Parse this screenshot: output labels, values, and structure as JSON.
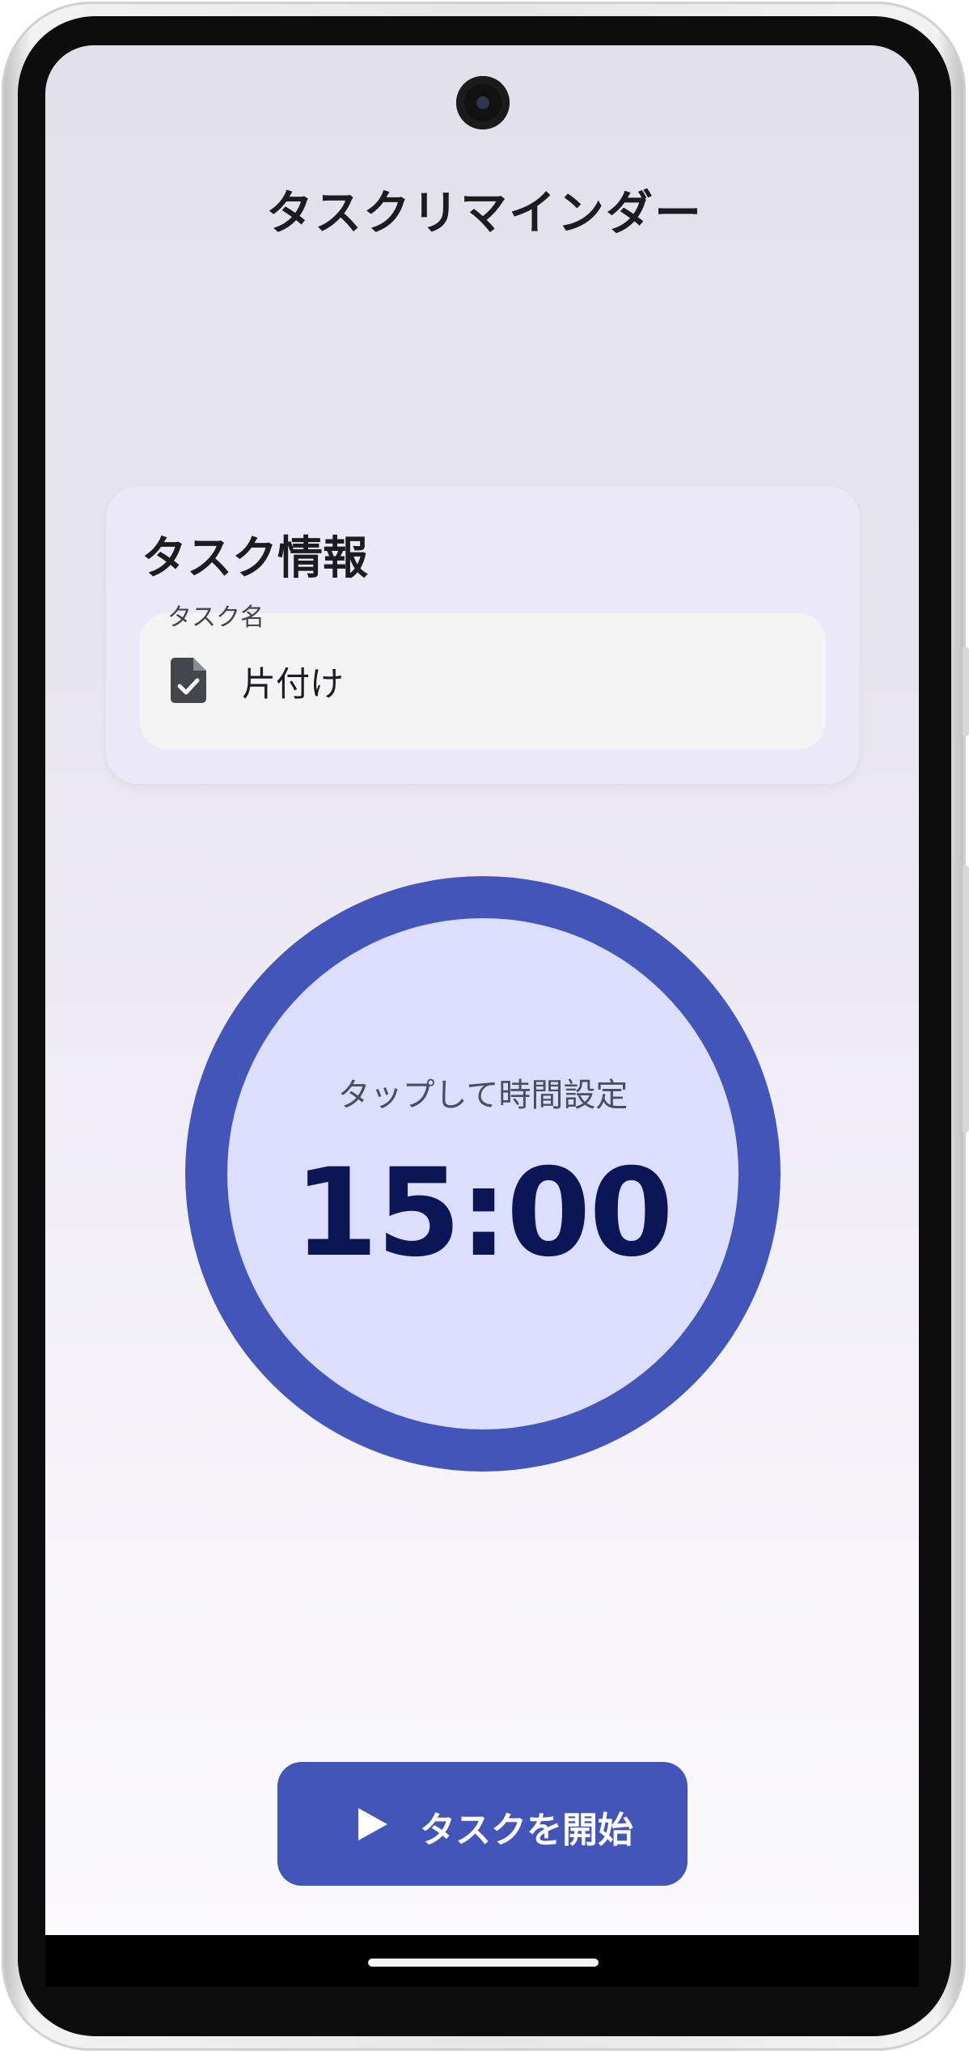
{
  "app": {
    "title": "タスクリマインダー"
  },
  "task_card": {
    "title": "タスク情報",
    "field_label": "タスク名",
    "field_value": "片付け",
    "field_icon": "task-file-check-icon"
  },
  "timer": {
    "hint": "タップして時間設定",
    "value": "15:00"
  },
  "start_button": {
    "label": "タスクを開始",
    "icon": "play-icon"
  },
  "colors": {
    "accent": "#4355b8",
    "timer_fill": "#dbdffb",
    "timer_text": "#0b1657",
    "card_bg": "#ebe9f7"
  }
}
